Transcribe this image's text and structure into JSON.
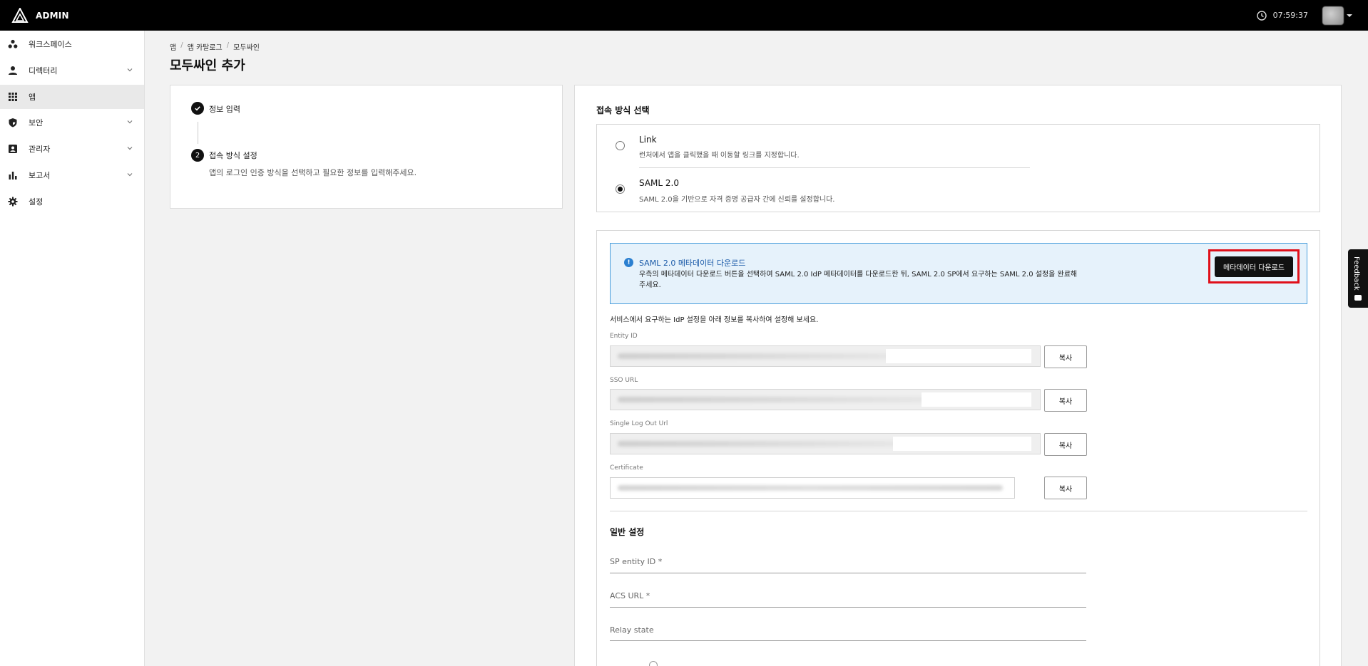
{
  "app": {
    "brand": "ADMIN",
    "time": "07:59:37"
  },
  "sidebar": {
    "items": [
      {
        "label": "워크스페이스",
        "icon": "workspace-icon",
        "active": false,
        "expandable": false
      },
      {
        "label": "디렉터리",
        "icon": "person-icon",
        "active": false,
        "expandable": true
      },
      {
        "label": "앱",
        "icon": "apps-grid-icon",
        "active": true,
        "expandable": false
      },
      {
        "label": "보안",
        "icon": "shield-icon",
        "active": false,
        "expandable": true
      },
      {
        "label": "관리자",
        "icon": "admin-badge-icon",
        "active": false,
        "expandable": true
      },
      {
        "label": "보고서",
        "icon": "bar-chart-icon",
        "active": false,
        "expandable": true
      },
      {
        "label": "설정",
        "icon": "gear-icon",
        "active": false,
        "expandable": false
      }
    ]
  },
  "breadcrumb": {
    "items": [
      "앱",
      "앱 카탈로그",
      "모두싸인"
    ],
    "separator": "/"
  },
  "page": {
    "title": "모두싸인 추가"
  },
  "steps": {
    "step1": {
      "title": "정보 입력",
      "status": "done"
    },
    "step2": {
      "number": "2",
      "title": "접속 방식 설정",
      "desc": "앱의 로그인 인증 방식을 선택하고 필요한 정보를 입력해주세요."
    }
  },
  "connection": {
    "title": "접속 방식 선택",
    "options": [
      {
        "title": "Link",
        "desc": "런처에서 앱을 클릭했을 때 이동할 링크를 지정합니다.",
        "selected": false
      },
      {
        "title": "SAML 2.0",
        "desc": "SAML 2.0을 기반으로 자격 증명 공급자 간에 신뢰를 설정합니다.",
        "selected": true
      }
    ]
  },
  "saml": {
    "info_title": "SAML 2.0 메타데이터 다운로드",
    "info_body": "우측의 메타데이터 다운로드 버튼을 선택하여 SAML 2.0 IdP 메타데이터를 다운로드한 뒤, SAML 2.0 SP에서 요구하는 SAML 2.0 설정을 완료해주세요.",
    "download_label": "메타데이터 다운로드",
    "copy_hint": "서비스에서 요구하는 IdP 설정을 아래 정보를 복사하여 설정해 보세요.",
    "fields": [
      {
        "label": "Entity ID",
        "copy_label": "복사"
      },
      {
        "label": "SSO URL",
        "copy_label": "복사"
      },
      {
        "label": "Single Log Out Url",
        "copy_label": "복사"
      },
      {
        "label": "Certificate",
        "copy_label": "복사"
      }
    ]
  },
  "general": {
    "title": "일반 설정",
    "sp_entity_placeholder": "SP entity ID *",
    "acs_placeholder": "ACS URL *",
    "relay_placeholder": "Relay state"
  },
  "feedback": {
    "label": "Feedback"
  },
  "colors": {
    "accent": "#111111",
    "info_bg": "#e6f2fb",
    "info_border": "#4a9fdc",
    "highlight": "#e0101a"
  }
}
